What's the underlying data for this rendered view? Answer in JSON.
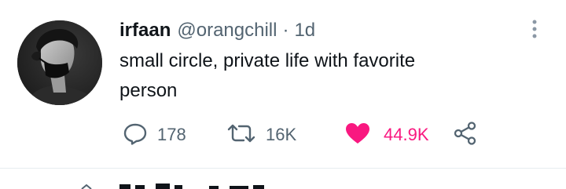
{
  "tweet": {
    "display_name": "irfaan",
    "handle": "@orangchill",
    "separator": "·",
    "timestamp": "1d",
    "text": "small circle, private life with favorite\nperson",
    "actions": {
      "reply_count": "178",
      "retweet_count": "16K",
      "like_count": "44.9K"
    },
    "icons": {
      "reply": "reply-icon",
      "retweet": "retweet-icon",
      "like": "heart-icon",
      "share": "share-icon",
      "more": "more-vertical-icon"
    }
  },
  "colors": {
    "text_primary": "#0f1419",
    "text_secondary": "#536471",
    "like_active": "#f91880",
    "divider": "#e6ecf0"
  }
}
